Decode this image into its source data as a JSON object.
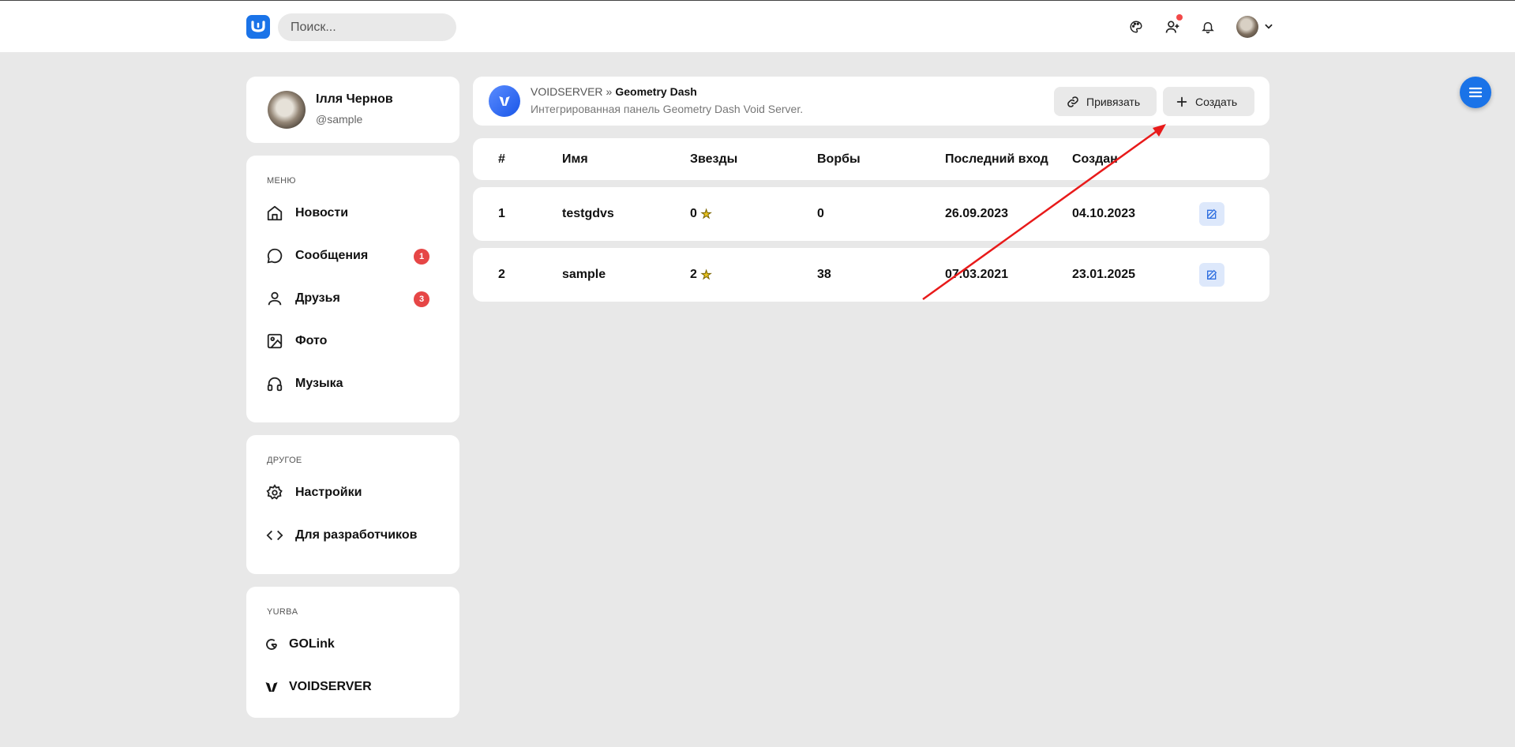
{
  "topbar": {
    "search_placeholder": "Поиск...",
    "icons": [
      "palette-icon",
      "add-friend-icon",
      "bell-icon"
    ]
  },
  "profile": {
    "name": "Ілля Чернов",
    "handle": "@sample"
  },
  "menu": {
    "title": "МЕНЮ",
    "items": [
      {
        "label": "Новости",
        "icon": "home-icon",
        "badge": ""
      },
      {
        "label": "Сообщения",
        "icon": "chat-icon",
        "badge": "1"
      },
      {
        "label": "Друзья",
        "icon": "user-icon",
        "badge": "3"
      },
      {
        "label": "Фото",
        "icon": "image-icon",
        "badge": ""
      },
      {
        "label": "Музыка",
        "icon": "headphones-icon",
        "badge": ""
      }
    ]
  },
  "other": {
    "title": "ДРУГОЕ",
    "items": [
      {
        "label": "Настройки",
        "icon": "gear-icon"
      },
      {
        "label": "Для разработчиков",
        "icon": "code-icon"
      }
    ]
  },
  "yurba": {
    "title": "YURBA",
    "items": [
      {
        "label": "GOLink",
        "icon": "golink-icon"
      },
      {
        "label": "VOIDSERVER",
        "icon": "voidserver-icon"
      }
    ]
  },
  "header": {
    "crumb_root": "VOIDSERVER",
    "crumb_sep": "»",
    "crumb_current": "Geometry Dash",
    "subtitle": "Интегрированная панель Geometry Dash Void Server.",
    "link_button": "Привязать",
    "create_button": "Создать"
  },
  "table": {
    "columns": [
      "#",
      "Имя",
      "Звезды",
      "Ворбы",
      "Последний вход",
      "Создан"
    ],
    "rows": [
      {
        "num": "1",
        "name": "testgdvs",
        "stars": "0",
        "vorbs": "0",
        "last_login": "26.09.2023",
        "created": "04.10.2023"
      },
      {
        "num": "2",
        "name": "sample",
        "stars": "2",
        "vorbs": "38",
        "last_login": "07.03.2021",
        "created": "23.01.2025"
      }
    ]
  },
  "colors": {
    "accent": "#1a73e8",
    "badge": "#e64646",
    "annotation_arrow": "#e81a1a"
  }
}
